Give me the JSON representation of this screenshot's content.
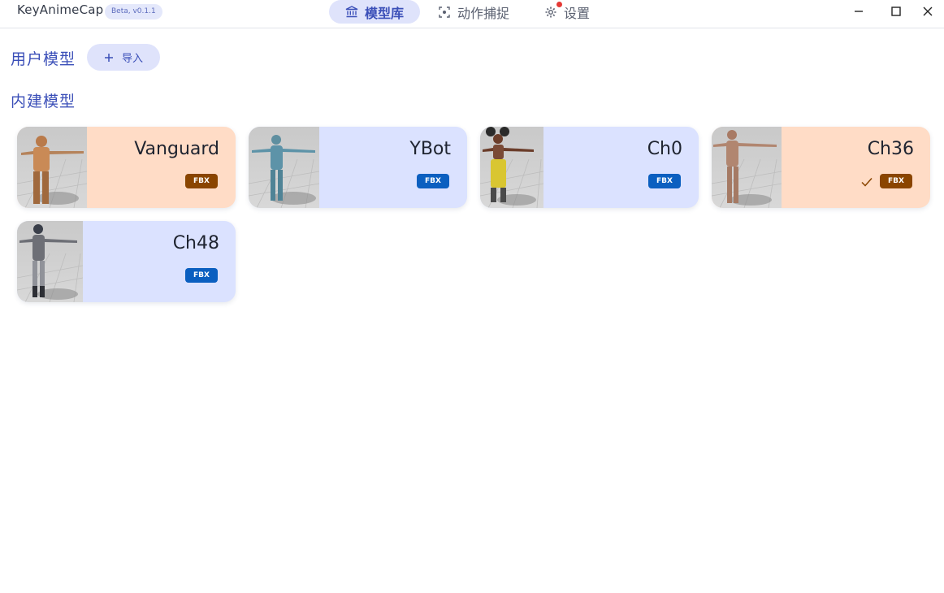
{
  "app": {
    "title": "KeyAnimeCap",
    "version": "Beta, v0.1.1"
  },
  "nav": {
    "tabs": [
      {
        "label": "模型库",
        "icon": "bank-icon",
        "active": true
      },
      {
        "label": "动作捕捉",
        "icon": "capture-icon",
        "active": false
      },
      {
        "label": "设置",
        "icon": "gear-icon",
        "active": false,
        "notification": true
      }
    ]
  },
  "window_controls": [
    "minimize-icon",
    "maximize-icon",
    "close-icon"
  ],
  "user_models": {
    "title": "用户模型",
    "import_label": "导入"
  },
  "builtin_models": {
    "title": "内建模型",
    "cards": [
      {
        "name": "Vanguard",
        "format": "FBX",
        "theme": "orange",
        "selected": false
      },
      {
        "name": "YBot",
        "format": "FBX",
        "theme": "blue",
        "selected": false
      },
      {
        "name": "Ch0",
        "format": "FBX",
        "theme": "blue",
        "selected": false
      },
      {
        "name": "Ch36",
        "format": "FBX",
        "theme": "orange",
        "selected": true
      },
      {
        "name": "Ch48",
        "format": "FBX",
        "theme": "blue",
        "selected": false
      }
    ]
  },
  "colors": {
    "accent": "#3b4fb8",
    "orange_card": "#ffdcc6",
    "blue_card": "#dbe2ff",
    "orange_badge": "#8a4500",
    "blue_badge": "#0b5fc0",
    "notification_dot": "#e53935"
  }
}
